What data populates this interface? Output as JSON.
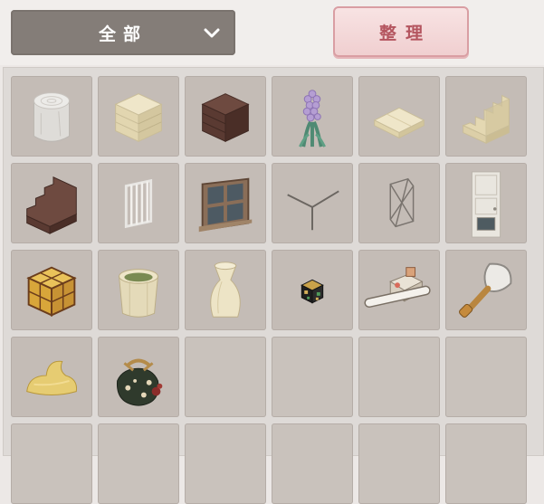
{
  "filter": {
    "label": "全部",
    "icon": "chevron-down-icon"
  },
  "sort_button": {
    "label": "整理"
  },
  "items": [
    "tree-stump-icon",
    "sandstone-block-icon",
    "dark-wood-block-icon",
    "hyacinth-icon",
    "sandstone-slab-icon",
    "sandstone-stairs-icon",
    "dark-wood-stairs-icon",
    "iron-bars-icon",
    "window-frame-icon",
    "corner-frame-icon",
    "frame-cube-icon",
    "door-icon",
    "lattice-lantern-icon",
    "planter-pot-icon",
    "vase-icon",
    "gem-block-icon",
    "road-roller-icon",
    "shovel-icon",
    "sand-pile-icon",
    "treasure-bag-icon",
    "",
    "",
    "",
    "",
    "",
    "",
    "",
    "",
    "",
    ""
  ],
  "colors": {
    "cell_bg": "#c4bcb6",
    "sort_accent": "#b4555f",
    "dropdown_bg": "#847d78"
  }
}
